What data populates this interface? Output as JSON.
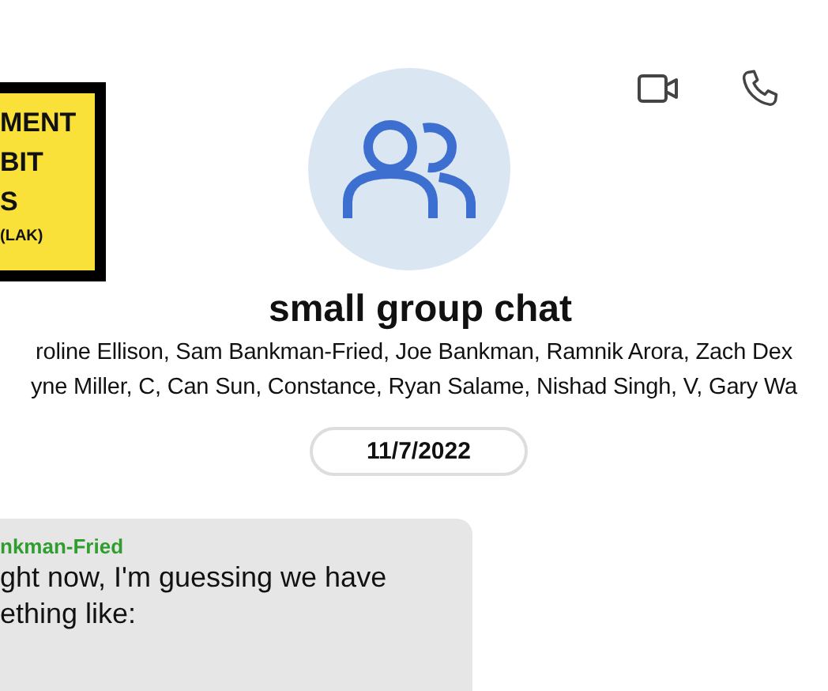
{
  "header_actions": [
    {
      "kind": "video"
    },
    {
      "kind": "phone"
    }
  ],
  "sign": {
    "lines": [
      {
        "text": "MENT",
        "kind": "large"
      },
      {
        "text": "BIT",
        "kind": "large"
      },
      {
        "text": "S",
        "kind": "large"
      },
      {
        "text": "(LAK)",
        "kind": "small"
      }
    ]
  },
  "chat": {
    "title": "small group chat",
    "members": [
      "roline Ellison, Sam Bankman-Fried, Joe Bankman, Ramnik Arora, Zach Dex",
      "yne Miller, C, Can Sun, Constance, Ryan Salame, Nishad Singh, V, Gary Wa"
    ]
  },
  "date_divider": "11/7/2022",
  "messages": [
    {
      "sender": "nkman-Fried",
      "lines": [
        "ght now, I'm guessing we have",
        "ething like:"
      ]
    }
  ]
}
